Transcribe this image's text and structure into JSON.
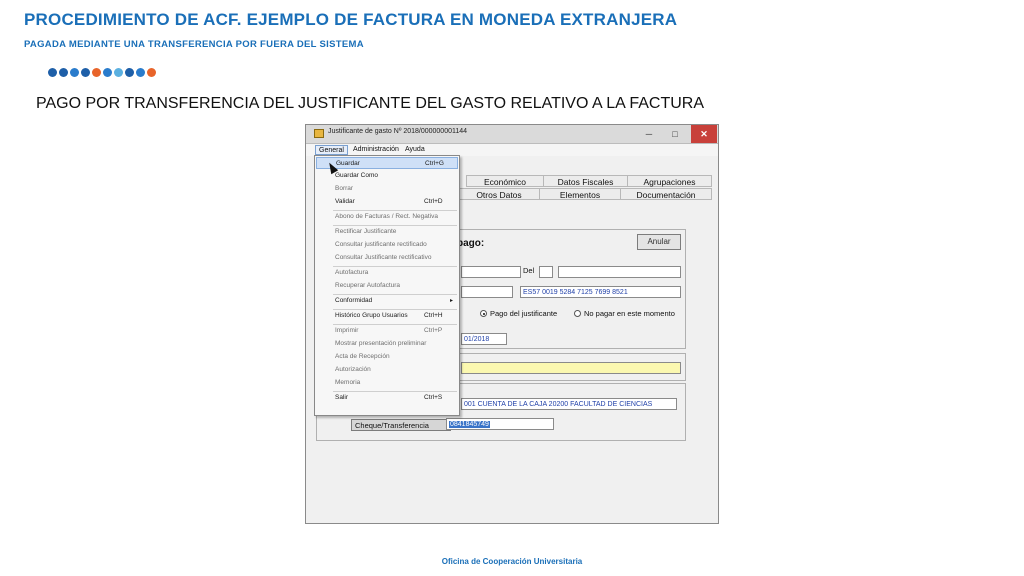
{
  "slide": {
    "title": "PROCEDIMIENTO DE ACF. EJEMPLO DE FACTURA EN MONEDA EXTRANJERA",
    "subtitle": "PAGADA MEDIANTE UNA TRANSFERENCIA POR FUERA DEL SISTEMA",
    "heading": "PAGO POR TRANSFERENCIA DEL JUSTIFICANTE DEL GASTO RELATIVO A LA FACTURA",
    "footer": "Oficina de Cooperación Universitaria",
    "dot_colors": [
      "#1e5fa8",
      "#1e5fa8",
      "#2a7ccc",
      "#1e5fa8",
      "#e8642a",
      "#2a7ccc",
      "#5bb0e0",
      "#1e5fa8",
      "#2a7ccc",
      "#e8642a"
    ]
  },
  "window": {
    "title": "Justificante de gasto Nº 2018/000000001144",
    "icon": "folder-icon",
    "controls": {
      "minimize": "─",
      "maximize": "□",
      "close": "✕"
    },
    "menu": [
      "General",
      "Administración",
      "Ayuda"
    ]
  },
  "tabs": {
    "row1": [
      "Económico",
      "Datos Fiscales",
      "Agrupaciones"
    ],
    "row2": [
      "Otros Datos",
      "Elementos",
      "Documentación"
    ]
  },
  "form": {
    "pago_label": "pago:",
    "anular_label": "Anular",
    "del_label": "Del",
    "iban_value": "ES57 0019 5284 7125 7699 8521",
    "radio_pago": "Pago del justificante",
    "radio_no_pagar": "No pagar en este momento",
    "fecha_value": "01/2018",
    "cuenta_value": "001 CUENTA DE LA CAJA 20200 FACULTAD DE CIENCIAS",
    "cheque_label": "Cheque/Transferencia",
    "cheque_value": "0841845749"
  },
  "dropdown": {
    "items": [
      {
        "label": "Guardar",
        "shortcut": "Ctrl+G",
        "state": "hover"
      },
      {
        "label": "Guardar Como",
        "shortcut": "",
        "state": "enabled"
      },
      {
        "label": "Borrar",
        "shortcut": "",
        "state": "disabled"
      },
      {
        "label": "Validar",
        "shortcut": "Ctrl+D",
        "state": "enabled"
      },
      {
        "label": "Abono de Facturas / Rect. Negativa",
        "shortcut": "",
        "state": "disabled"
      },
      {
        "label": "Rectificar Justificante",
        "shortcut": "",
        "state": "disabled"
      },
      {
        "label": "Consultar justificante rectificado",
        "shortcut": "",
        "state": "disabled"
      },
      {
        "label": "Consultar Justificante rectificativo",
        "shortcut": "",
        "state": "disabled"
      },
      {
        "label": "Autofactura",
        "shortcut": "",
        "state": "disabled"
      },
      {
        "label": "Recuperar Autofactura",
        "shortcut": "",
        "state": "disabled"
      },
      {
        "label": "Conformidad",
        "shortcut": "",
        "state": "enabled",
        "submenu": true
      },
      {
        "label": "Histórico Grupo Usuarios",
        "shortcut": "Ctrl+H",
        "state": "enabled"
      },
      {
        "label": "Imprimir",
        "shortcut": "Ctrl+P",
        "state": "disabled"
      },
      {
        "label": "Mostrar presentación preliminar",
        "shortcut": "",
        "state": "disabled"
      },
      {
        "label": "Acta de Recepción",
        "shortcut": "",
        "state": "disabled"
      },
      {
        "label": "Autorización",
        "shortcut": "",
        "state": "disabled"
      },
      {
        "label": "Memoria",
        "shortcut": "",
        "state": "disabled"
      },
      {
        "label": "Salir",
        "shortcut": "Ctrl+S",
        "state": "enabled"
      }
    ],
    "submenu_arrow": "▸"
  }
}
